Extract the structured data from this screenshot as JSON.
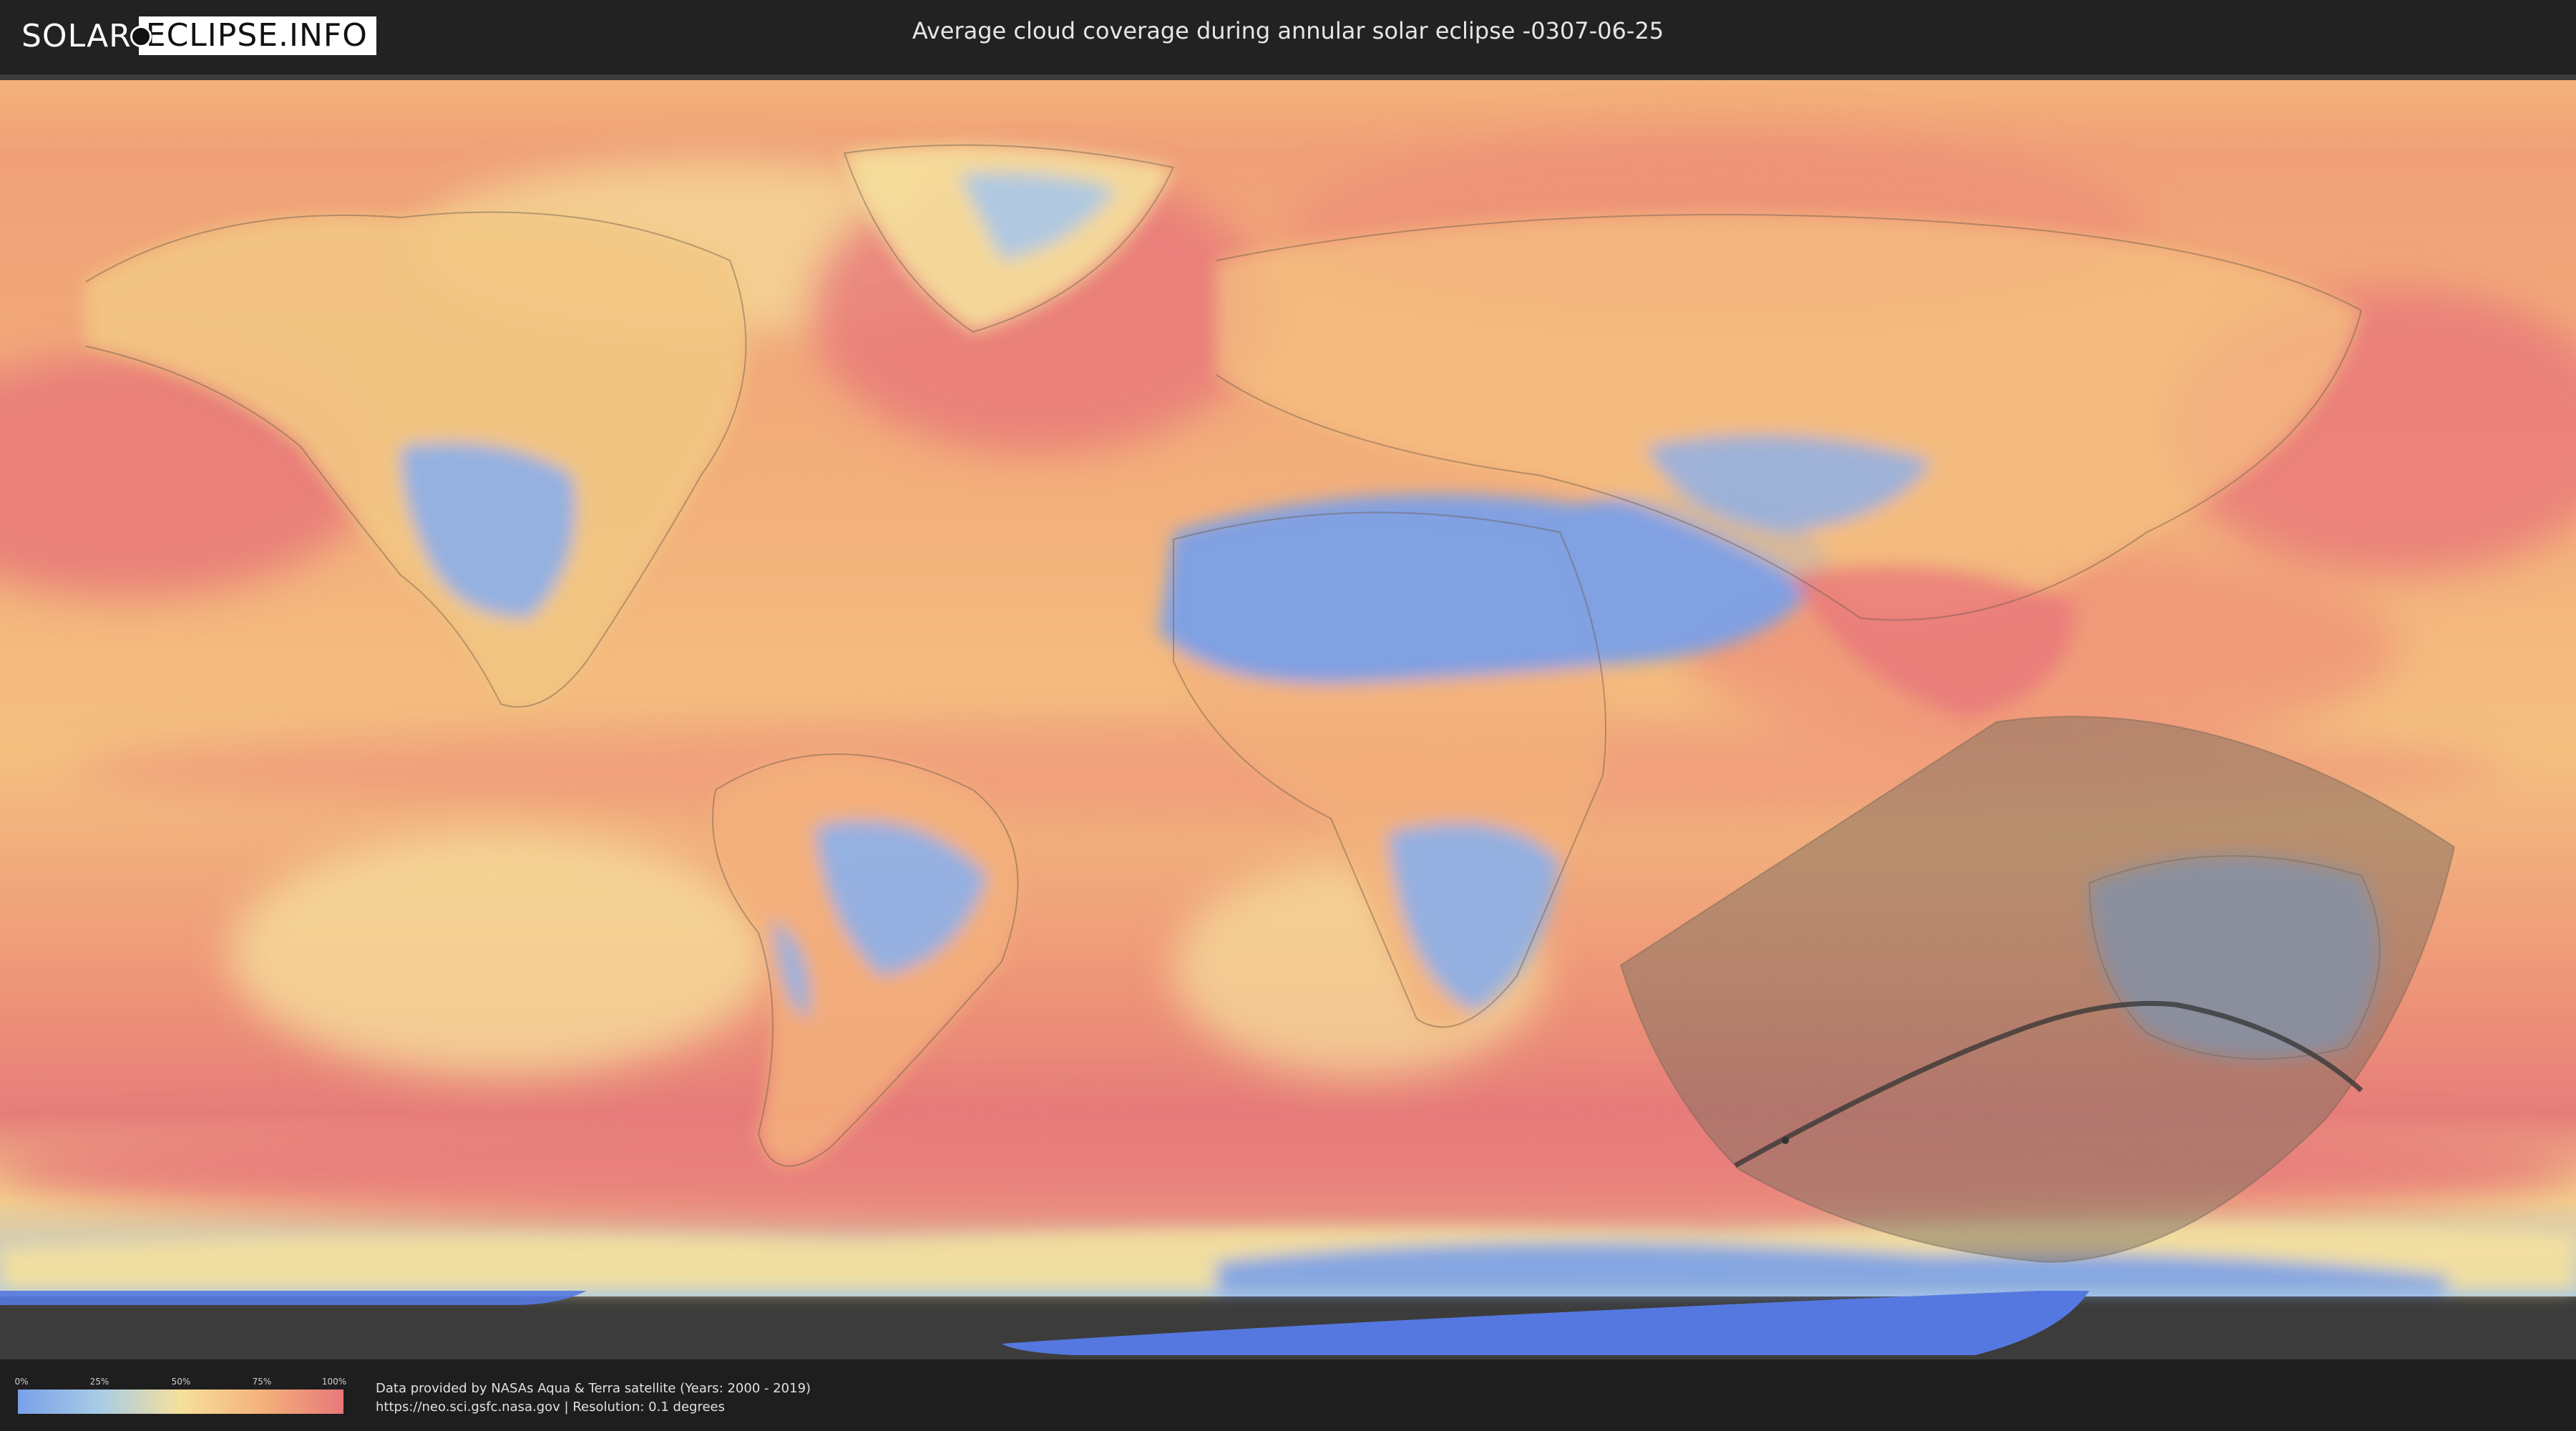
{
  "logo": {
    "part1": "SOLAR",
    "part2": "ECLIPSE.INFO"
  },
  "title": "Average cloud coverage during annular solar eclipse -0307-06-25",
  "legend": {
    "ticks": [
      "0%",
      "25%",
      "50%",
      "75%",
      "100%"
    ]
  },
  "credits": {
    "line1": "Data provided by NASAs Aqua & Terra satellite (Years: 2000 - 2019)",
    "line2": "https://neo.sci.gsfc.nasa.gov | Resolution: 0.1 degrees"
  },
  "colors": {
    "clear": "#7aa0e8",
    "low": "#a8cce6",
    "mid": "#f5e09c",
    "high": "#f4b27a",
    "overcast": "#e8787a",
    "shadow_overlay": "#8a7a5a",
    "background": "#222222"
  }
}
